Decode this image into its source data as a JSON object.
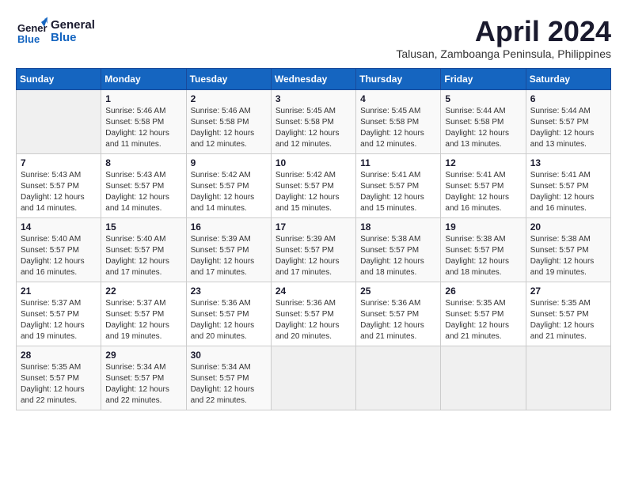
{
  "header": {
    "logo_general": "General",
    "logo_blue": "Blue",
    "month_year": "April 2024",
    "location": "Talusan, Zamboanga Peninsula, Philippines"
  },
  "weekdays": [
    "Sunday",
    "Monday",
    "Tuesday",
    "Wednesday",
    "Thursday",
    "Friday",
    "Saturday"
  ],
  "weeks": [
    [
      {
        "day": "",
        "info": ""
      },
      {
        "day": "1",
        "info": "Sunrise: 5:46 AM\nSunset: 5:58 PM\nDaylight: 12 hours\nand 11 minutes."
      },
      {
        "day": "2",
        "info": "Sunrise: 5:46 AM\nSunset: 5:58 PM\nDaylight: 12 hours\nand 12 minutes."
      },
      {
        "day": "3",
        "info": "Sunrise: 5:45 AM\nSunset: 5:58 PM\nDaylight: 12 hours\nand 12 minutes."
      },
      {
        "day": "4",
        "info": "Sunrise: 5:45 AM\nSunset: 5:58 PM\nDaylight: 12 hours\nand 12 minutes."
      },
      {
        "day": "5",
        "info": "Sunrise: 5:44 AM\nSunset: 5:58 PM\nDaylight: 12 hours\nand 13 minutes."
      },
      {
        "day": "6",
        "info": "Sunrise: 5:44 AM\nSunset: 5:57 PM\nDaylight: 12 hours\nand 13 minutes."
      }
    ],
    [
      {
        "day": "7",
        "info": "Sunrise: 5:43 AM\nSunset: 5:57 PM\nDaylight: 12 hours\nand 14 minutes."
      },
      {
        "day": "8",
        "info": "Sunrise: 5:43 AM\nSunset: 5:57 PM\nDaylight: 12 hours\nand 14 minutes."
      },
      {
        "day": "9",
        "info": "Sunrise: 5:42 AM\nSunset: 5:57 PM\nDaylight: 12 hours\nand 14 minutes."
      },
      {
        "day": "10",
        "info": "Sunrise: 5:42 AM\nSunset: 5:57 PM\nDaylight: 12 hours\nand 15 minutes."
      },
      {
        "day": "11",
        "info": "Sunrise: 5:41 AM\nSunset: 5:57 PM\nDaylight: 12 hours\nand 15 minutes."
      },
      {
        "day": "12",
        "info": "Sunrise: 5:41 AM\nSunset: 5:57 PM\nDaylight: 12 hours\nand 16 minutes."
      },
      {
        "day": "13",
        "info": "Sunrise: 5:41 AM\nSunset: 5:57 PM\nDaylight: 12 hours\nand 16 minutes."
      }
    ],
    [
      {
        "day": "14",
        "info": "Sunrise: 5:40 AM\nSunset: 5:57 PM\nDaylight: 12 hours\nand 16 minutes."
      },
      {
        "day": "15",
        "info": "Sunrise: 5:40 AM\nSunset: 5:57 PM\nDaylight: 12 hours\nand 17 minutes."
      },
      {
        "day": "16",
        "info": "Sunrise: 5:39 AM\nSunset: 5:57 PM\nDaylight: 12 hours\nand 17 minutes."
      },
      {
        "day": "17",
        "info": "Sunrise: 5:39 AM\nSunset: 5:57 PM\nDaylight: 12 hours\nand 17 minutes."
      },
      {
        "day": "18",
        "info": "Sunrise: 5:38 AM\nSunset: 5:57 PM\nDaylight: 12 hours\nand 18 minutes."
      },
      {
        "day": "19",
        "info": "Sunrise: 5:38 AM\nSunset: 5:57 PM\nDaylight: 12 hours\nand 18 minutes."
      },
      {
        "day": "20",
        "info": "Sunrise: 5:38 AM\nSunset: 5:57 PM\nDaylight: 12 hours\nand 19 minutes."
      }
    ],
    [
      {
        "day": "21",
        "info": "Sunrise: 5:37 AM\nSunset: 5:57 PM\nDaylight: 12 hours\nand 19 minutes."
      },
      {
        "day": "22",
        "info": "Sunrise: 5:37 AM\nSunset: 5:57 PM\nDaylight: 12 hours\nand 19 minutes."
      },
      {
        "day": "23",
        "info": "Sunrise: 5:36 AM\nSunset: 5:57 PM\nDaylight: 12 hours\nand 20 minutes."
      },
      {
        "day": "24",
        "info": "Sunrise: 5:36 AM\nSunset: 5:57 PM\nDaylight: 12 hours\nand 20 minutes."
      },
      {
        "day": "25",
        "info": "Sunrise: 5:36 AM\nSunset: 5:57 PM\nDaylight: 12 hours\nand 21 minutes."
      },
      {
        "day": "26",
        "info": "Sunrise: 5:35 AM\nSunset: 5:57 PM\nDaylight: 12 hours\nand 21 minutes."
      },
      {
        "day": "27",
        "info": "Sunrise: 5:35 AM\nSunset: 5:57 PM\nDaylight: 12 hours\nand 21 minutes."
      }
    ],
    [
      {
        "day": "28",
        "info": "Sunrise: 5:35 AM\nSunset: 5:57 PM\nDaylight: 12 hours\nand 22 minutes."
      },
      {
        "day": "29",
        "info": "Sunrise: 5:34 AM\nSunset: 5:57 PM\nDaylight: 12 hours\nand 22 minutes."
      },
      {
        "day": "30",
        "info": "Sunrise: 5:34 AM\nSunset: 5:57 PM\nDaylight: 12 hours\nand 22 minutes."
      },
      {
        "day": "",
        "info": ""
      },
      {
        "day": "",
        "info": ""
      },
      {
        "day": "",
        "info": ""
      },
      {
        "day": "",
        "info": ""
      }
    ]
  ]
}
